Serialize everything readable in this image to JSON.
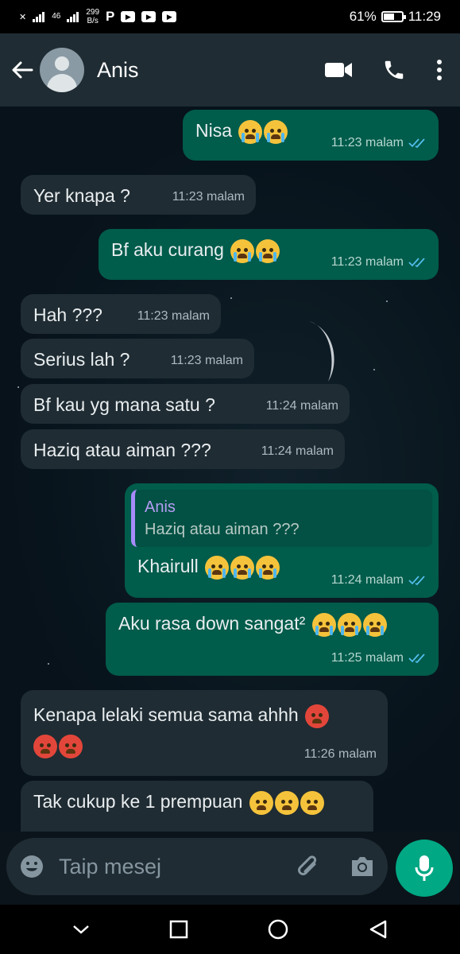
{
  "status_bar": {
    "signal_text": "46",
    "net_speed": "299",
    "net_speed_unit": "B/s",
    "app_p": "P",
    "battery_percent": "61%",
    "battery_level": 0.61,
    "time": "11:29"
  },
  "header": {
    "contact_name": "Anis",
    "back_icon": "arrow-left-icon",
    "video_icon": "video-call-icon",
    "call_icon": "phone-icon",
    "menu_icon": "more-vertical-icon"
  },
  "messages": [
    {
      "dir": "out",
      "text": "Nisa",
      "emoji": [
        "crying",
        "crying"
      ],
      "time": "11:23 malam",
      "read": true
    },
    {
      "dir": "in",
      "text": "Yer knapa ?",
      "time": "11:23 malam"
    },
    {
      "dir": "out",
      "text": "Bf aku curang",
      "emoji": [
        "crying",
        "crying"
      ],
      "time": "11:23 malam",
      "read": true
    },
    {
      "dir": "in",
      "text": "Hah ???",
      "time": "11:23 malam"
    },
    {
      "dir": "in",
      "text": "Serius lah ?",
      "time": "11:23 malam"
    },
    {
      "dir": "in",
      "text": "Bf kau yg mana satu ?",
      "time": "11:24 malam"
    },
    {
      "dir": "in",
      "text": "Haziq atau aiman ???",
      "time": "11:24 malam"
    },
    {
      "dir": "out",
      "reply_author": "Anis",
      "reply_text": "Haziq atau aiman ???",
      "text": "Khairull",
      "emoji": [
        "crying",
        "crying",
        "crying"
      ],
      "time": "11:24 malam",
      "read": true
    },
    {
      "dir": "out",
      "text": "Aku rasa down sangat²",
      "emoji": [
        "crying",
        "crying",
        "crying"
      ],
      "time": "11:25 malam",
      "read": true
    },
    {
      "dir": "in",
      "text": "Kenapa lelaki semua sama ahhh",
      "emoji": [
        "angry",
        "angry",
        "angry"
      ],
      "time": "11:26 malam"
    },
    {
      "dir": "in",
      "text": "Tak cukup ke 1 prempuan",
      "emoji": [
        "steam",
        "steam",
        "steam"
      ]
    }
  ],
  "input": {
    "placeholder": "Taip mesej",
    "emoji_icon": "emoji-icon",
    "attach_icon": "paperclip-icon",
    "camera_icon": "camera-icon",
    "mic_icon": "microphone-icon"
  },
  "colors": {
    "incoming_bubble": "#1f2c33",
    "outgoing_bubble": "#005c4b",
    "accent": "#00a884",
    "read_tick": "#53bdeb"
  }
}
